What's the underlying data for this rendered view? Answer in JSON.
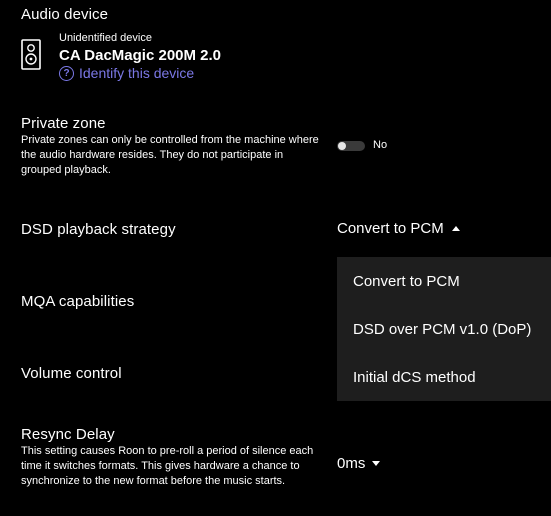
{
  "audio_device": {
    "heading": "Audio device",
    "sub_label": "Unidentified device",
    "device_name": "CA DacMagic 200M 2.0",
    "identify_link": "Identify this device",
    "icon": "speaker-icon"
  },
  "private_zone": {
    "heading": "Private zone",
    "description": "Private zones can only be controlled from the machine where the audio hardware resides. They do not participate in grouped playback.",
    "toggle_state": "No"
  },
  "dsd_playback": {
    "heading": "DSD playback strategy",
    "selected": "Convert to PCM",
    "options": [
      "Convert to PCM",
      "DSD over PCM v1.0 (DoP)",
      "Initial dCS method"
    ]
  },
  "mqa": {
    "heading": "MQA capabilities"
  },
  "volume": {
    "heading": "Volume control"
  },
  "resync": {
    "heading": "Resync Delay",
    "description": "This setting causes Roon to pre-roll a period of silence each time it switches formats. This gives hardware a chance to synchronize to the new format before the music starts.",
    "selected": "0ms"
  },
  "colors": {
    "background": "#000000",
    "link": "#7b78e6",
    "menu_background": "#1e1e1e"
  }
}
